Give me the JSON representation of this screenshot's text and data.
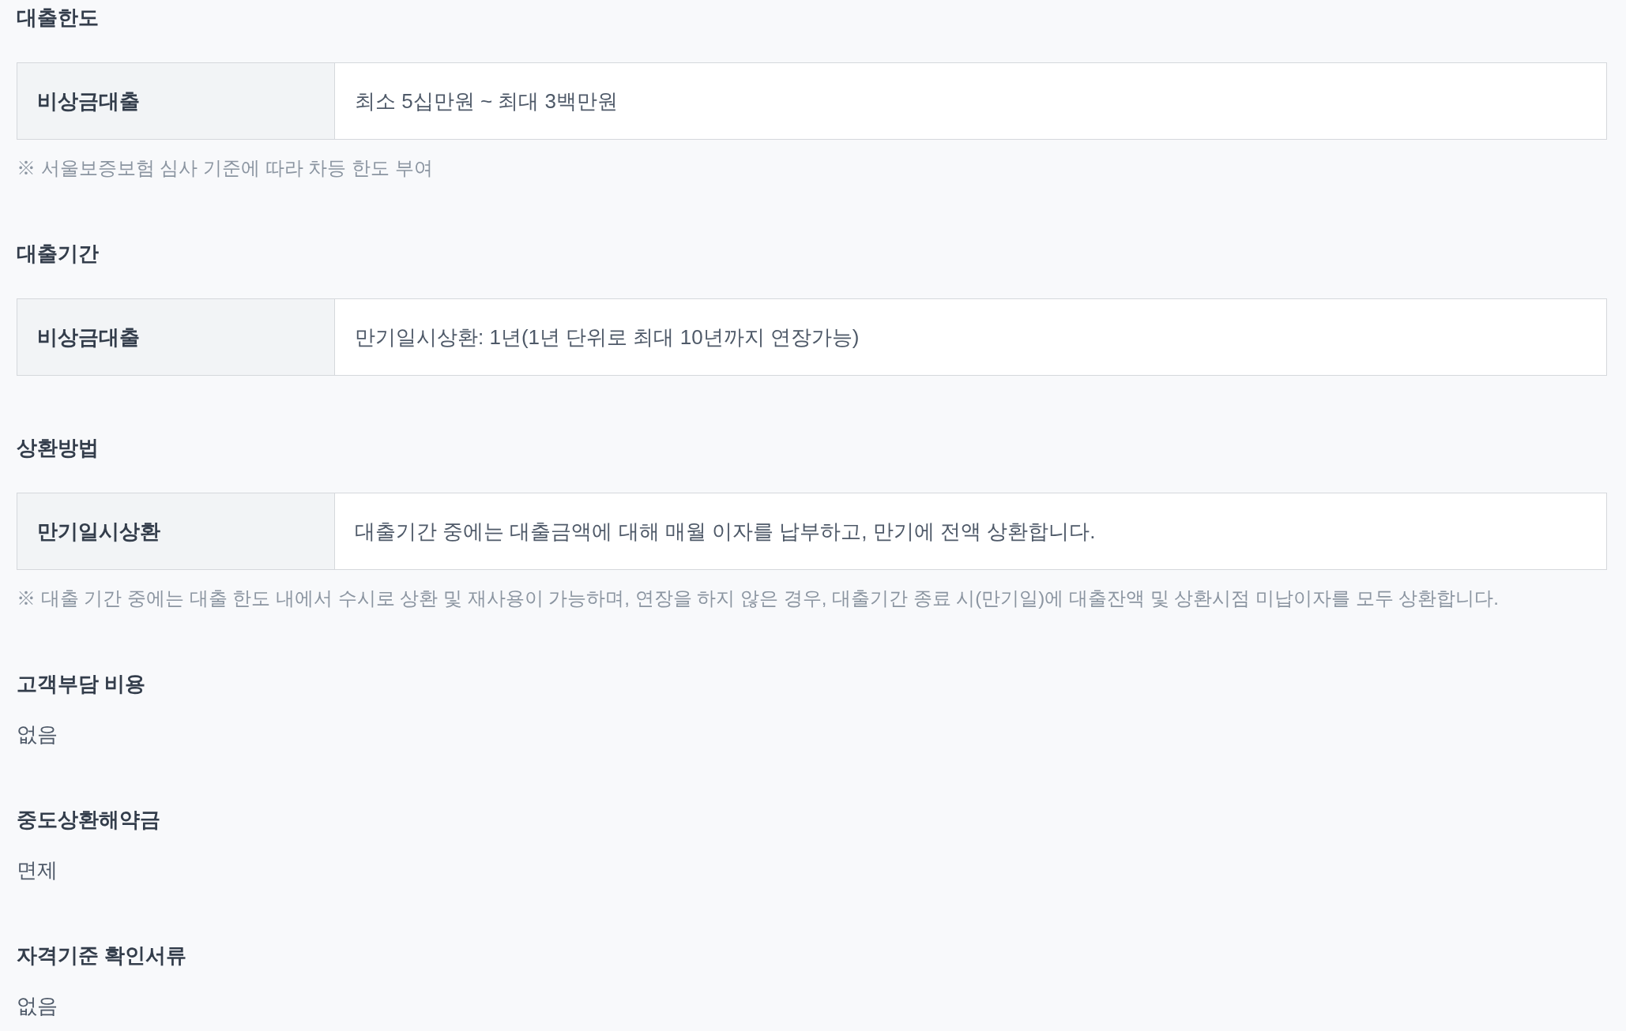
{
  "sections": [
    {
      "title": "대출한도",
      "kind": "table",
      "rows": [
        {
          "label": "비상금대출",
          "value": "최소 5십만원 ~ 최대 3백만원"
        }
      ],
      "note": "※ 서울보증보험 심사 기준에 따라 차등 한도 부여"
    },
    {
      "title": "대출기간",
      "kind": "table",
      "rows": [
        {
          "label": "비상금대출",
          "value": "만기일시상환: 1년(1년 단위로 최대 10년까지 연장가능)"
        }
      ]
    },
    {
      "title": "상환방법",
      "kind": "table",
      "rows": [
        {
          "label": "만기일시상환",
          "value": "대출기간 중에는 대출금액에 대해 매월 이자를 납부하고, 만기에 전액 상환합니다."
        }
      ],
      "note": "※ 대출 기간 중에는 대출 한도 내에서 수시로 상환 및 재사용이 가능하며, 연장을 하지 않은 경우, 대출기간 종료 시(만기일)에 대출잔액 및 상환시점 미납이자를 모두 상환합니다."
    },
    {
      "title": "고객부담 비용",
      "kind": "text",
      "text": "없음"
    },
    {
      "title": "중도상환해약금",
      "kind": "text",
      "text": "면제"
    },
    {
      "title": "자격기준 확인서류",
      "kind": "text",
      "text": "없음"
    }
  ]
}
